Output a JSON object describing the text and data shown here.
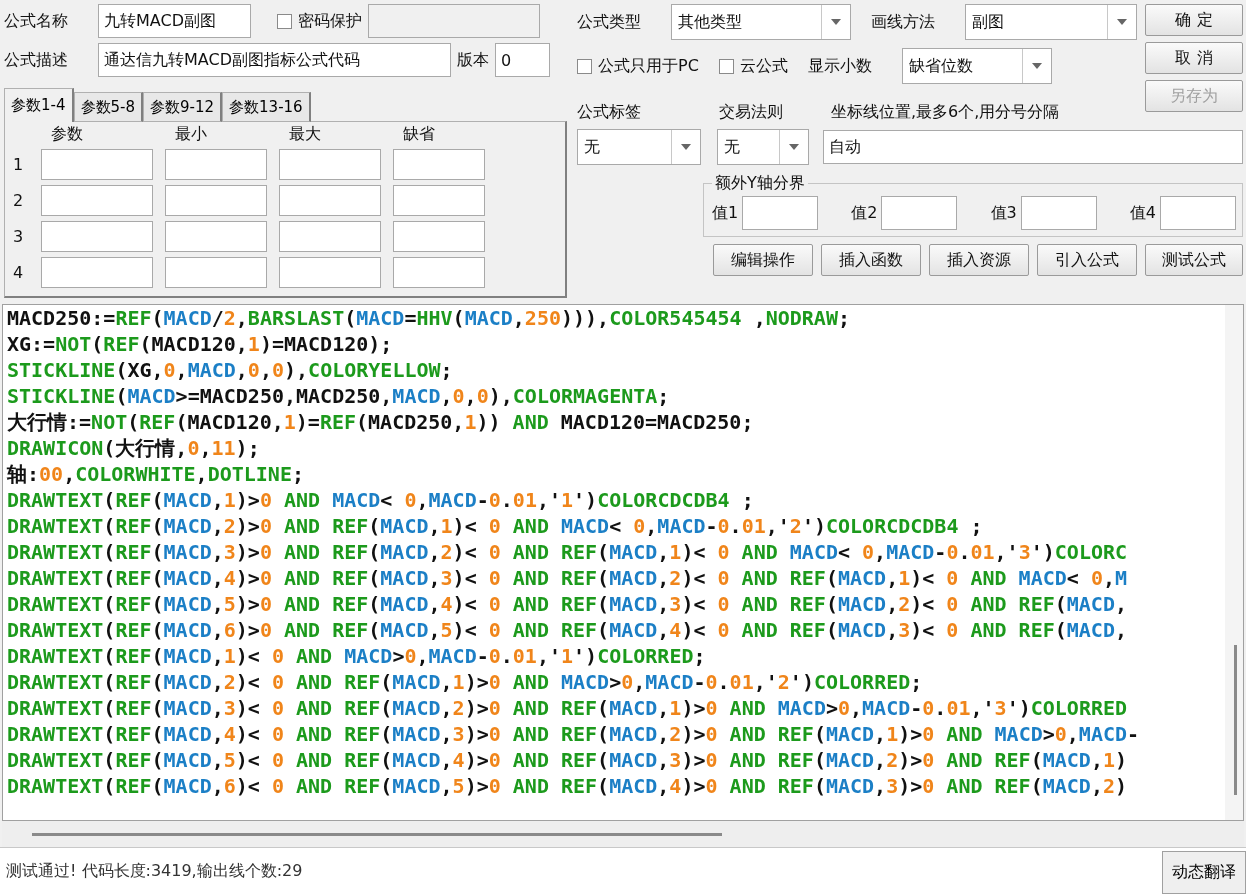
{
  "formula_name": {
    "label": "公式名称",
    "value": "九转MACD副图"
  },
  "password_protect": {
    "label": "密码保护",
    "checked": false
  },
  "password_field": {
    "disabled": true
  },
  "description": {
    "label": "公式描述",
    "value": "通达信九转MACD副图指标公式代码"
  },
  "version": {
    "label": "版本",
    "value": "0"
  },
  "param_tabs": [
    {
      "label": "参数1-4",
      "selected": true
    },
    {
      "label": "参数5-8",
      "selected": false
    },
    {
      "label": "参数9-12",
      "selected": false
    },
    {
      "label": "参数13-16",
      "selected": false
    }
  ],
  "param_table": {
    "columns": [
      "参数",
      "最小",
      "最大",
      "缺省"
    ],
    "rows": [
      {
        "index": "1"
      },
      {
        "index": "2"
      },
      {
        "index": "3"
      },
      {
        "index": "4"
      }
    ]
  },
  "formula_type": {
    "label": "公式类型",
    "value": "其他类型"
  },
  "draw_method": {
    "label": "画线方法",
    "value": "副图"
  },
  "pc_only": {
    "label": "公式只用于PC",
    "checked": false
  },
  "cloud": {
    "label": "云公式",
    "checked": false
  },
  "decimals": {
    "label": "显示小数",
    "value": "缺省位数"
  },
  "buttons": [
    {
      "label": "确 定",
      "disabled": false
    },
    {
      "label": "取 消",
      "disabled": false
    },
    {
      "label": "另存为",
      "disabled": true
    }
  ],
  "tag": {
    "label": "公式标签",
    "value": "无"
  },
  "trade_rule": {
    "label": "交易法则",
    "value": "无"
  },
  "axis_lines": {
    "label": "坐标线位置,最多6个,用分号分隔",
    "value": "自动"
  },
  "y_bounds": {
    "title": "额外Y轴分界",
    "fields": [
      {
        "label": "值1"
      },
      {
        "label": "值2"
      },
      {
        "label": "值3"
      },
      {
        "label": "值4"
      }
    ]
  },
  "action_buttons": [
    "编辑操作",
    "插入函数",
    "插入资源",
    "引入公式",
    "测试公式"
  ],
  "code_lines": [
    [
      {
        "kind": "txt",
        "text": "MACD250:="
      },
      {
        "kind": "fn",
        "text": "REF"
      },
      {
        "kind": "txt",
        "text": "("
      },
      {
        "kind": "var",
        "text": "MACD"
      },
      {
        "kind": "txt",
        "text": "/"
      },
      {
        "kind": "num",
        "text": "2"
      },
      {
        "kind": "txt",
        "text": ","
      },
      {
        "kind": "fn",
        "text": "BARSLAST"
      },
      {
        "kind": "txt",
        "text": "("
      },
      {
        "kind": "var",
        "text": "MACD"
      },
      {
        "kind": "txt",
        "text": "="
      },
      {
        "kind": "fn",
        "text": "HHV"
      },
      {
        "kind": "txt",
        "text": "("
      },
      {
        "kind": "var",
        "text": "MACD"
      },
      {
        "kind": "txt",
        "text": ","
      },
      {
        "kind": "num",
        "text": "250"
      },
      {
        "kind": "txt",
        "text": "))),"
      },
      {
        "kind": "fn",
        "text": "COLOR545454"
      },
      {
        "kind": "txt",
        "text": " ,"
      },
      {
        "kind": "fn",
        "text": "NODRAW"
      },
      {
        "kind": "txt",
        "text": ";"
      }
    ],
    [
      {
        "kind": "txt",
        "text": "XG:="
      },
      {
        "kind": "fn",
        "text": "NOT"
      },
      {
        "kind": "txt",
        "text": "("
      },
      {
        "kind": "fn",
        "text": "REF"
      },
      {
        "kind": "txt",
        "text": "(MACD120,"
      },
      {
        "kind": "num",
        "text": "1"
      },
      {
        "kind": "txt",
        "text": ")=MACD120);"
      }
    ],
    [
      {
        "kind": "fn",
        "text": "STICKLINE"
      },
      {
        "kind": "txt",
        "text": "(XG,"
      },
      {
        "kind": "num",
        "text": "0"
      },
      {
        "kind": "txt",
        "text": ","
      },
      {
        "kind": "var",
        "text": "MACD"
      },
      {
        "kind": "txt",
        "text": ","
      },
      {
        "kind": "num",
        "text": "0"
      },
      {
        "kind": "txt",
        "text": ","
      },
      {
        "kind": "num",
        "text": "0"
      },
      {
        "kind": "txt",
        "text": "),"
      },
      {
        "kind": "fn",
        "text": "COLORYELLOW"
      },
      {
        "kind": "txt",
        "text": ";"
      }
    ],
    [
      {
        "kind": "fn",
        "text": "STICKLINE"
      },
      {
        "kind": "txt",
        "text": "("
      },
      {
        "kind": "var",
        "text": "MACD"
      },
      {
        "kind": "txt",
        "text": ">=MACD250,MACD250,"
      },
      {
        "kind": "var",
        "text": "MACD"
      },
      {
        "kind": "txt",
        "text": ","
      },
      {
        "kind": "num",
        "text": "0"
      },
      {
        "kind": "txt",
        "text": ","
      },
      {
        "kind": "num",
        "text": "0"
      },
      {
        "kind": "txt",
        "text": "),"
      },
      {
        "kind": "fn",
        "text": "COLORMAGENTA"
      },
      {
        "kind": "txt",
        "text": ";"
      }
    ],
    [
      {
        "kind": "txt",
        "text": "大行情:="
      },
      {
        "kind": "fn",
        "text": "NOT"
      },
      {
        "kind": "txt",
        "text": "("
      },
      {
        "kind": "fn",
        "text": "REF"
      },
      {
        "kind": "txt",
        "text": "(MACD120,"
      },
      {
        "kind": "num",
        "text": "1"
      },
      {
        "kind": "txt",
        "text": ")="
      },
      {
        "kind": "fn",
        "text": "REF"
      },
      {
        "kind": "txt",
        "text": "(MACD250,"
      },
      {
        "kind": "num",
        "text": "1"
      },
      {
        "kind": "txt",
        "text": "))"
      },
      {
        "kind": "fn",
        "text": " AND "
      },
      {
        "kind": "txt",
        "text": "MACD120=MACD250;"
      }
    ],
    [
      {
        "kind": "fn",
        "text": "DRAWICON"
      },
      {
        "kind": "txt",
        "text": "(大行情,"
      },
      {
        "kind": "num",
        "text": "0"
      },
      {
        "kind": "txt",
        "text": ","
      },
      {
        "kind": "num",
        "text": "11"
      },
      {
        "kind": "txt",
        "text": ");"
      }
    ],
    [
      {
        "kind": "txt",
        "text": "轴:"
      },
      {
        "kind": "num",
        "text": "00"
      },
      {
        "kind": "txt",
        "text": ","
      },
      {
        "kind": "fn",
        "text": "COLORWHITE"
      },
      {
        "kind": "txt",
        "text": ","
      },
      {
        "kind": "fn",
        "text": "DOTLINE"
      },
      {
        "kind": "txt",
        "text": ";"
      }
    ],
    [
      {
        "kind": "fn",
        "text": "DRAWTEXT"
      },
      {
        "kind": "txt",
        "text": "("
      },
      {
        "kind": "fn",
        "text": "REF"
      },
      {
        "kind": "txt",
        "text": "("
      },
      {
        "kind": "var",
        "text": "MACD"
      },
      {
        "kind": "txt",
        "text": ","
      },
      {
        "kind": "num",
        "text": "1"
      },
      {
        "kind": "txt",
        "text": ")>"
      },
      {
        "kind": "num",
        "text": "0"
      },
      {
        "kind": "fn",
        "text": " AND "
      },
      {
        "kind": "var",
        "text": "MACD"
      },
      {
        "kind": "txt",
        "text": "< "
      },
      {
        "kind": "num",
        "text": "0"
      },
      {
        "kind": "txt",
        "text": ","
      },
      {
        "kind": "var",
        "text": "MACD"
      },
      {
        "kind": "txt",
        "text": "-"
      },
      {
        "kind": "num",
        "text": "0"
      },
      {
        "kind": "txt",
        "text": "."
      },
      {
        "kind": "num",
        "text": "01"
      },
      {
        "kind": "txt",
        "text": ",'"
      },
      {
        "kind": "num",
        "text": "1"
      },
      {
        "kind": "txt",
        "text": "')"
      },
      {
        "kind": "fn",
        "text": "COLORCDCDB4"
      },
      {
        "kind": "txt",
        "text": " ;"
      }
    ],
    [
      {
        "kind": "fn",
        "text": "DRAWTEXT"
      },
      {
        "kind": "txt",
        "text": "("
      },
      {
        "kind": "fn",
        "text": "REF"
      },
      {
        "kind": "txt",
        "text": "("
      },
      {
        "kind": "var",
        "text": "MACD"
      },
      {
        "kind": "txt",
        "text": ","
      },
      {
        "kind": "num",
        "text": "2"
      },
      {
        "kind": "txt",
        "text": ")>"
      },
      {
        "kind": "num",
        "text": "0"
      },
      {
        "kind": "fn",
        "text": " AND REF"
      },
      {
        "kind": "txt",
        "text": "("
      },
      {
        "kind": "var",
        "text": "MACD"
      },
      {
        "kind": "txt",
        "text": ","
      },
      {
        "kind": "num",
        "text": "1"
      },
      {
        "kind": "txt",
        "text": ")< "
      },
      {
        "kind": "num",
        "text": "0"
      },
      {
        "kind": "fn",
        "text": " AND "
      },
      {
        "kind": "var",
        "text": "MACD"
      },
      {
        "kind": "txt",
        "text": "< "
      },
      {
        "kind": "num",
        "text": "0"
      },
      {
        "kind": "txt",
        "text": ","
      },
      {
        "kind": "var",
        "text": "MACD"
      },
      {
        "kind": "txt",
        "text": "-"
      },
      {
        "kind": "num",
        "text": "0"
      },
      {
        "kind": "txt",
        "text": "."
      },
      {
        "kind": "num",
        "text": "01"
      },
      {
        "kind": "txt",
        "text": ",'"
      },
      {
        "kind": "num",
        "text": "2"
      },
      {
        "kind": "txt",
        "text": "')"
      },
      {
        "kind": "fn",
        "text": "COLORCDCDB4"
      },
      {
        "kind": "txt",
        "text": " ;"
      }
    ],
    [
      {
        "kind": "fn",
        "text": "DRAWTEXT"
      },
      {
        "kind": "txt",
        "text": "("
      },
      {
        "kind": "fn",
        "text": "REF"
      },
      {
        "kind": "txt",
        "text": "("
      },
      {
        "kind": "var",
        "text": "MACD"
      },
      {
        "kind": "txt",
        "text": ","
      },
      {
        "kind": "num",
        "text": "3"
      },
      {
        "kind": "txt",
        "text": ")>"
      },
      {
        "kind": "num",
        "text": "0"
      },
      {
        "kind": "fn",
        "text": " AND REF"
      },
      {
        "kind": "txt",
        "text": "("
      },
      {
        "kind": "var",
        "text": "MACD"
      },
      {
        "kind": "txt",
        "text": ","
      },
      {
        "kind": "num",
        "text": "2"
      },
      {
        "kind": "txt",
        "text": ")< "
      },
      {
        "kind": "num",
        "text": "0"
      },
      {
        "kind": "fn",
        "text": " AND REF"
      },
      {
        "kind": "txt",
        "text": "("
      },
      {
        "kind": "var",
        "text": "MACD"
      },
      {
        "kind": "txt",
        "text": ","
      },
      {
        "kind": "num",
        "text": "1"
      },
      {
        "kind": "txt",
        "text": ")< "
      },
      {
        "kind": "num",
        "text": "0"
      },
      {
        "kind": "fn",
        "text": " AND "
      },
      {
        "kind": "var",
        "text": "MACD"
      },
      {
        "kind": "txt",
        "text": "< "
      },
      {
        "kind": "num",
        "text": "0"
      },
      {
        "kind": "txt",
        "text": ","
      },
      {
        "kind": "var",
        "text": "MACD"
      },
      {
        "kind": "txt",
        "text": "-"
      },
      {
        "kind": "num",
        "text": "0"
      },
      {
        "kind": "txt",
        "text": "."
      },
      {
        "kind": "num",
        "text": "01"
      },
      {
        "kind": "txt",
        "text": ",'"
      },
      {
        "kind": "num",
        "text": "3"
      },
      {
        "kind": "txt",
        "text": "')"
      },
      {
        "kind": "fn",
        "text": "COLORC"
      }
    ],
    [
      {
        "kind": "fn",
        "text": "DRAWTEXT"
      },
      {
        "kind": "txt",
        "text": "("
      },
      {
        "kind": "fn",
        "text": "REF"
      },
      {
        "kind": "txt",
        "text": "("
      },
      {
        "kind": "var",
        "text": "MACD"
      },
      {
        "kind": "txt",
        "text": ","
      },
      {
        "kind": "num",
        "text": "4"
      },
      {
        "kind": "txt",
        "text": ")>"
      },
      {
        "kind": "num",
        "text": "0"
      },
      {
        "kind": "fn",
        "text": " AND REF"
      },
      {
        "kind": "txt",
        "text": "("
      },
      {
        "kind": "var",
        "text": "MACD"
      },
      {
        "kind": "txt",
        "text": ","
      },
      {
        "kind": "num",
        "text": "3"
      },
      {
        "kind": "txt",
        "text": ")< "
      },
      {
        "kind": "num",
        "text": "0"
      },
      {
        "kind": "fn",
        "text": " AND REF"
      },
      {
        "kind": "txt",
        "text": "("
      },
      {
        "kind": "var",
        "text": "MACD"
      },
      {
        "kind": "txt",
        "text": ","
      },
      {
        "kind": "num",
        "text": "2"
      },
      {
        "kind": "txt",
        "text": ")< "
      },
      {
        "kind": "num",
        "text": "0"
      },
      {
        "kind": "fn",
        "text": " AND REF"
      },
      {
        "kind": "txt",
        "text": "("
      },
      {
        "kind": "var",
        "text": "MACD"
      },
      {
        "kind": "txt",
        "text": ","
      },
      {
        "kind": "num",
        "text": "1"
      },
      {
        "kind": "txt",
        "text": ")< "
      },
      {
        "kind": "num",
        "text": "0"
      },
      {
        "kind": "fn",
        "text": " AND "
      },
      {
        "kind": "var",
        "text": "MACD"
      },
      {
        "kind": "txt",
        "text": "< "
      },
      {
        "kind": "num",
        "text": "0"
      },
      {
        "kind": "txt",
        "text": ","
      },
      {
        "kind": "var",
        "text": "M"
      }
    ],
    [
      {
        "kind": "fn",
        "text": "DRAWTEXT"
      },
      {
        "kind": "txt",
        "text": "("
      },
      {
        "kind": "fn",
        "text": "REF"
      },
      {
        "kind": "txt",
        "text": "("
      },
      {
        "kind": "var",
        "text": "MACD"
      },
      {
        "kind": "txt",
        "text": ","
      },
      {
        "kind": "num",
        "text": "5"
      },
      {
        "kind": "txt",
        "text": ")>"
      },
      {
        "kind": "num",
        "text": "0"
      },
      {
        "kind": "fn",
        "text": " AND REF"
      },
      {
        "kind": "txt",
        "text": "("
      },
      {
        "kind": "var",
        "text": "MACD"
      },
      {
        "kind": "txt",
        "text": ","
      },
      {
        "kind": "num",
        "text": "4"
      },
      {
        "kind": "txt",
        "text": ")< "
      },
      {
        "kind": "num",
        "text": "0"
      },
      {
        "kind": "fn",
        "text": " AND REF"
      },
      {
        "kind": "txt",
        "text": "("
      },
      {
        "kind": "var",
        "text": "MACD"
      },
      {
        "kind": "txt",
        "text": ","
      },
      {
        "kind": "num",
        "text": "3"
      },
      {
        "kind": "txt",
        "text": ")< "
      },
      {
        "kind": "num",
        "text": "0"
      },
      {
        "kind": "fn",
        "text": " AND REF"
      },
      {
        "kind": "txt",
        "text": "("
      },
      {
        "kind": "var",
        "text": "MACD"
      },
      {
        "kind": "txt",
        "text": ","
      },
      {
        "kind": "num",
        "text": "2"
      },
      {
        "kind": "txt",
        "text": ")< "
      },
      {
        "kind": "num",
        "text": "0"
      },
      {
        "kind": "fn",
        "text": " AND REF"
      },
      {
        "kind": "txt",
        "text": "("
      },
      {
        "kind": "var",
        "text": "MACD"
      },
      {
        "kind": "txt",
        "text": ","
      }
    ],
    [
      {
        "kind": "fn",
        "text": "DRAWTEXT"
      },
      {
        "kind": "txt",
        "text": "("
      },
      {
        "kind": "fn",
        "text": "REF"
      },
      {
        "kind": "txt",
        "text": "("
      },
      {
        "kind": "var",
        "text": "MACD"
      },
      {
        "kind": "txt",
        "text": ","
      },
      {
        "kind": "num",
        "text": "6"
      },
      {
        "kind": "txt",
        "text": ")>"
      },
      {
        "kind": "num",
        "text": "0"
      },
      {
        "kind": "fn",
        "text": " AND REF"
      },
      {
        "kind": "txt",
        "text": "("
      },
      {
        "kind": "var",
        "text": "MACD"
      },
      {
        "kind": "txt",
        "text": ","
      },
      {
        "kind": "num",
        "text": "5"
      },
      {
        "kind": "txt",
        "text": ")< "
      },
      {
        "kind": "num",
        "text": "0"
      },
      {
        "kind": "fn",
        "text": " AND REF"
      },
      {
        "kind": "txt",
        "text": "("
      },
      {
        "kind": "var",
        "text": "MACD"
      },
      {
        "kind": "txt",
        "text": ","
      },
      {
        "kind": "num",
        "text": "4"
      },
      {
        "kind": "txt",
        "text": ")< "
      },
      {
        "kind": "num",
        "text": "0"
      },
      {
        "kind": "fn",
        "text": " AND REF"
      },
      {
        "kind": "txt",
        "text": "("
      },
      {
        "kind": "var",
        "text": "MACD"
      },
      {
        "kind": "txt",
        "text": ","
      },
      {
        "kind": "num",
        "text": "3"
      },
      {
        "kind": "txt",
        "text": ")< "
      },
      {
        "kind": "num",
        "text": "0"
      },
      {
        "kind": "fn",
        "text": " AND REF"
      },
      {
        "kind": "txt",
        "text": "("
      },
      {
        "kind": "var",
        "text": "MACD"
      },
      {
        "kind": "txt",
        "text": ","
      }
    ],
    [
      {
        "kind": "fn",
        "text": "DRAWTEXT"
      },
      {
        "kind": "txt",
        "text": "("
      },
      {
        "kind": "fn",
        "text": "REF"
      },
      {
        "kind": "txt",
        "text": "("
      },
      {
        "kind": "var",
        "text": "MACD"
      },
      {
        "kind": "txt",
        "text": ","
      },
      {
        "kind": "num",
        "text": "1"
      },
      {
        "kind": "txt",
        "text": ")< "
      },
      {
        "kind": "num",
        "text": "0"
      },
      {
        "kind": "fn",
        "text": " AND "
      },
      {
        "kind": "var",
        "text": "MACD"
      },
      {
        "kind": "txt",
        "text": ">"
      },
      {
        "kind": "num",
        "text": "0"
      },
      {
        "kind": "txt",
        "text": ","
      },
      {
        "kind": "var",
        "text": "MACD"
      },
      {
        "kind": "txt",
        "text": "-"
      },
      {
        "kind": "num",
        "text": "0"
      },
      {
        "kind": "txt",
        "text": "."
      },
      {
        "kind": "num",
        "text": "01"
      },
      {
        "kind": "txt",
        "text": ",'"
      },
      {
        "kind": "num",
        "text": "1"
      },
      {
        "kind": "txt",
        "text": "')"
      },
      {
        "kind": "fn",
        "text": "COLORRED"
      },
      {
        "kind": "txt",
        "text": ";"
      }
    ],
    [
      {
        "kind": "fn",
        "text": "DRAWTEXT"
      },
      {
        "kind": "txt",
        "text": "("
      },
      {
        "kind": "fn",
        "text": "REF"
      },
      {
        "kind": "txt",
        "text": "("
      },
      {
        "kind": "var",
        "text": "MACD"
      },
      {
        "kind": "txt",
        "text": ","
      },
      {
        "kind": "num",
        "text": "2"
      },
      {
        "kind": "txt",
        "text": ")< "
      },
      {
        "kind": "num",
        "text": "0"
      },
      {
        "kind": "fn",
        "text": " AND REF"
      },
      {
        "kind": "txt",
        "text": "("
      },
      {
        "kind": "var",
        "text": "MACD"
      },
      {
        "kind": "txt",
        "text": ","
      },
      {
        "kind": "num",
        "text": "1"
      },
      {
        "kind": "txt",
        "text": ")>"
      },
      {
        "kind": "num",
        "text": "0"
      },
      {
        "kind": "fn",
        "text": " AND "
      },
      {
        "kind": "var",
        "text": "MACD"
      },
      {
        "kind": "txt",
        "text": ">"
      },
      {
        "kind": "num",
        "text": "0"
      },
      {
        "kind": "txt",
        "text": ","
      },
      {
        "kind": "var",
        "text": "MACD"
      },
      {
        "kind": "txt",
        "text": "-"
      },
      {
        "kind": "num",
        "text": "0"
      },
      {
        "kind": "txt",
        "text": "."
      },
      {
        "kind": "num",
        "text": "01"
      },
      {
        "kind": "txt",
        "text": ",'"
      },
      {
        "kind": "num",
        "text": "2"
      },
      {
        "kind": "txt",
        "text": "')"
      },
      {
        "kind": "fn",
        "text": "COLORRED"
      },
      {
        "kind": "txt",
        "text": ";"
      }
    ],
    [
      {
        "kind": "fn",
        "text": "DRAWTEXT"
      },
      {
        "kind": "txt",
        "text": "("
      },
      {
        "kind": "fn",
        "text": "REF"
      },
      {
        "kind": "txt",
        "text": "("
      },
      {
        "kind": "var",
        "text": "MACD"
      },
      {
        "kind": "txt",
        "text": ","
      },
      {
        "kind": "num",
        "text": "3"
      },
      {
        "kind": "txt",
        "text": ")< "
      },
      {
        "kind": "num",
        "text": "0"
      },
      {
        "kind": "fn",
        "text": " AND REF"
      },
      {
        "kind": "txt",
        "text": "("
      },
      {
        "kind": "var",
        "text": "MACD"
      },
      {
        "kind": "txt",
        "text": ","
      },
      {
        "kind": "num",
        "text": "2"
      },
      {
        "kind": "txt",
        "text": ")>"
      },
      {
        "kind": "num",
        "text": "0"
      },
      {
        "kind": "fn",
        "text": " AND REF"
      },
      {
        "kind": "txt",
        "text": "("
      },
      {
        "kind": "var",
        "text": "MACD"
      },
      {
        "kind": "txt",
        "text": ","
      },
      {
        "kind": "num",
        "text": "1"
      },
      {
        "kind": "txt",
        "text": ")>"
      },
      {
        "kind": "num",
        "text": "0"
      },
      {
        "kind": "fn",
        "text": " AND "
      },
      {
        "kind": "var",
        "text": "MACD"
      },
      {
        "kind": "txt",
        "text": ">"
      },
      {
        "kind": "num",
        "text": "0"
      },
      {
        "kind": "txt",
        "text": ","
      },
      {
        "kind": "var",
        "text": "MACD"
      },
      {
        "kind": "txt",
        "text": "-"
      },
      {
        "kind": "num",
        "text": "0"
      },
      {
        "kind": "txt",
        "text": "."
      },
      {
        "kind": "num",
        "text": "01"
      },
      {
        "kind": "txt",
        "text": ",'"
      },
      {
        "kind": "num",
        "text": "3"
      },
      {
        "kind": "txt",
        "text": "')"
      },
      {
        "kind": "fn",
        "text": "COLORRED"
      }
    ],
    [
      {
        "kind": "fn",
        "text": "DRAWTEXT"
      },
      {
        "kind": "txt",
        "text": "("
      },
      {
        "kind": "fn",
        "text": "REF"
      },
      {
        "kind": "txt",
        "text": "("
      },
      {
        "kind": "var",
        "text": "MACD"
      },
      {
        "kind": "txt",
        "text": ","
      },
      {
        "kind": "num",
        "text": "4"
      },
      {
        "kind": "txt",
        "text": ")< "
      },
      {
        "kind": "num",
        "text": "0"
      },
      {
        "kind": "fn",
        "text": " AND REF"
      },
      {
        "kind": "txt",
        "text": "("
      },
      {
        "kind": "var",
        "text": "MACD"
      },
      {
        "kind": "txt",
        "text": ","
      },
      {
        "kind": "num",
        "text": "3"
      },
      {
        "kind": "txt",
        "text": ")>"
      },
      {
        "kind": "num",
        "text": "0"
      },
      {
        "kind": "fn",
        "text": " AND REF"
      },
      {
        "kind": "txt",
        "text": "("
      },
      {
        "kind": "var",
        "text": "MACD"
      },
      {
        "kind": "txt",
        "text": ","
      },
      {
        "kind": "num",
        "text": "2"
      },
      {
        "kind": "txt",
        "text": ")>"
      },
      {
        "kind": "num",
        "text": "0"
      },
      {
        "kind": "fn",
        "text": " AND REF"
      },
      {
        "kind": "txt",
        "text": "("
      },
      {
        "kind": "var",
        "text": "MACD"
      },
      {
        "kind": "txt",
        "text": ","
      },
      {
        "kind": "num",
        "text": "1"
      },
      {
        "kind": "txt",
        "text": ")>"
      },
      {
        "kind": "num",
        "text": "0"
      },
      {
        "kind": "fn",
        "text": " AND "
      },
      {
        "kind": "var",
        "text": "MACD"
      },
      {
        "kind": "txt",
        "text": ">"
      },
      {
        "kind": "num",
        "text": "0"
      },
      {
        "kind": "txt",
        "text": ","
      },
      {
        "kind": "var",
        "text": "MACD"
      },
      {
        "kind": "txt",
        "text": "-"
      }
    ],
    [
      {
        "kind": "fn",
        "text": "DRAWTEXT"
      },
      {
        "kind": "txt",
        "text": "("
      },
      {
        "kind": "fn",
        "text": "REF"
      },
      {
        "kind": "txt",
        "text": "("
      },
      {
        "kind": "var",
        "text": "MACD"
      },
      {
        "kind": "txt",
        "text": ","
      },
      {
        "kind": "num",
        "text": "5"
      },
      {
        "kind": "txt",
        "text": ")< "
      },
      {
        "kind": "num",
        "text": "0"
      },
      {
        "kind": "fn",
        "text": " AND REF"
      },
      {
        "kind": "txt",
        "text": "("
      },
      {
        "kind": "var",
        "text": "MACD"
      },
      {
        "kind": "txt",
        "text": ","
      },
      {
        "kind": "num",
        "text": "4"
      },
      {
        "kind": "txt",
        "text": ")>"
      },
      {
        "kind": "num",
        "text": "0"
      },
      {
        "kind": "fn",
        "text": " AND REF"
      },
      {
        "kind": "txt",
        "text": "("
      },
      {
        "kind": "var",
        "text": "MACD"
      },
      {
        "kind": "txt",
        "text": ","
      },
      {
        "kind": "num",
        "text": "3"
      },
      {
        "kind": "txt",
        "text": ")>"
      },
      {
        "kind": "num",
        "text": "0"
      },
      {
        "kind": "fn",
        "text": " AND REF"
      },
      {
        "kind": "txt",
        "text": "("
      },
      {
        "kind": "var",
        "text": "MACD"
      },
      {
        "kind": "txt",
        "text": ","
      },
      {
        "kind": "num",
        "text": "2"
      },
      {
        "kind": "txt",
        "text": ")>"
      },
      {
        "kind": "num",
        "text": "0"
      },
      {
        "kind": "fn",
        "text": " AND REF"
      },
      {
        "kind": "txt",
        "text": "("
      },
      {
        "kind": "var",
        "text": "MACD"
      },
      {
        "kind": "txt",
        "text": ","
      },
      {
        "kind": "num",
        "text": "1"
      },
      {
        "kind": "txt",
        "text": ")"
      }
    ],
    [
      {
        "kind": "fn",
        "text": "DRAWTEXT"
      },
      {
        "kind": "txt",
        "text": "("
      },
      {
        "kind": "fn",
        "text": "REF"
      },
      {
        "kind": "txt",
        "text": "("
      },
      {
        "kind": "var",
        "text": "MACD"
      },
      {
        "kind": "txt",
        "text": ","
      },
      {
        "kind": "num",
        "text": "6"
      },
      {
        "kind": "txt",
        "text": ")< "
      },
      {
        "kind": "num",
        "text": "0"
      },
      {
        "kind": "fn",
        "text": " AND REF"
      },
      {
        "kind": "txt",
        "text": "("
      },
      {
        "kind": "var",
        "text": "MACD"
      },
      {
        "kind": "txt",
        "text": ","
      },
      {
        "kind": "num",
        "text": "5"
      },
      {
        "kind": "txt",
        "text": ")>"
      },
      {
        "kind": "num",
        "text": "0"
      },
      {
        "kind": "fn",
        "text": " AND REF"
      },
      {
        "kind": "txt",
        "text": "("
      },
      {
        "kind": "var",
        "text": "MACD"
      },
      {
        "kind": "txt",
        "text": ","
      },
      {
        "kind": "num",
        "text": "4"
      },
      {
        "kind": "txt",
        "text": ")>"
      },
      {
        "kind": "num",
        "text": "0"
      },
      {
        "kind": "fn",
        "text": " AND REF"
      },
      {
        "kind": "txt",
        "text": "("
      },
      {
        "kind": "var",
        "text": "MACD"
      },
      {
        "kind": "txt",
        "text": ","
      },
      {
        "kind": "num",
        "text": "3"
      },
      {
        "kind": "txt",
        "text": ")>"
      },
      {
        "kind": "num",
        "text": "0"
      },
      {
        "kind": "fn",
        "text": " AND REF"
      },
      {
        "kind": "txt",
        "text": "("
      },
      {
        "kind": "var",
        "text": "MACD"
      },
      {
        "kind": "txt",
        "text": ","
      },
      {
        "kind": "num",
        "text": "2"
      },
      {
        "kind": "txt",
        "text": ")"
      }
    ]
  ],
  "status_bar": {
    "message": "测试通过! 代码长度:3419,输出线个数:29",
    "button": "动态翻译"
  }
}
